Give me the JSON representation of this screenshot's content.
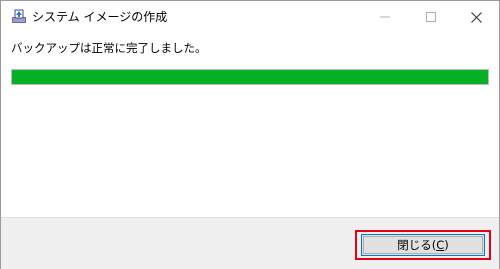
{
  "window": {
    "title": "システム イメージの作成",
    "controls": {
      "minimize": "minimize",
      "maximize": "maximize",
      "close": "close"
    }
  },
  "main": {
    "message": "バックアップは正常に完了しました。",
    "progress": {
      "percent": 100,
      "color": "#06b025"
    }
  },
  "footer": {
    "close_label_prefix": "閉じる(",
    "close_label_accel": "C",
    "close_label_suffix": ")",
    "highlight_color": "#e60012"
  },
  "icons": {
    "app": "backup-app-icon",
    "minimize": "minimize-icon",
    "maximize": "maximize-icon",
    "close": "close-icon"
  }
}
